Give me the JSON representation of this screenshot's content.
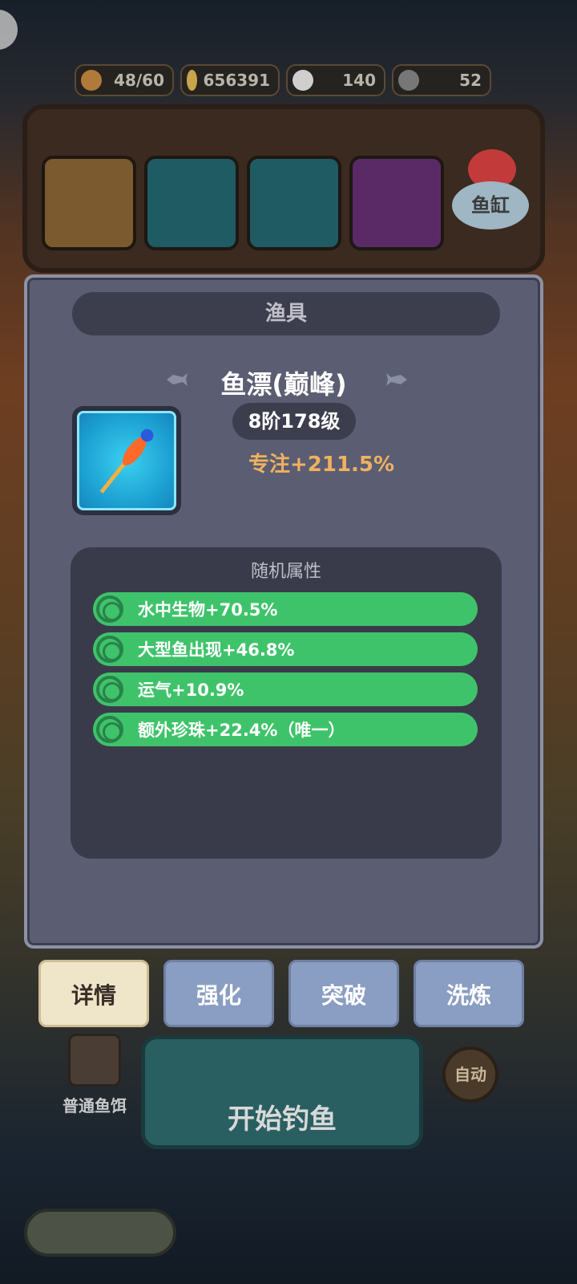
{
  "resources": [
    {
      "icon": "stamina-icon",
      "value": "48/60"
    },
    {
      "icon": "gold-coin-icon",
      "value": "656391"
    },
    {
      "icon": "pearl-icon",
      "value": "140"
    },
    {
      "icon": "fishing-line-icon",
      "value": "52"
    }
  ],
  "gear_slots": [
    {
      "name": "rod-icon"
    },
    {
      "name": "reel-icon"
    },
    {
      "name": "float-icon"
    },
    {
      "name": "hook-icon"
    }
  ],
  "fish_tank": {
    "label": "鱼缸"
  },
  "panel": {
    "header": "渔具",
    "item_name": "鱼漂(巅峰)",
    "level": "8阶178级",
    "main_stat": "专注+211.5%",
    "attributes_title": "随机属性",
    "attributes": [
      "水中生物+70.5%",
      "大型鱼出现+46.8%",
      "运气+10.9%",
      "额外珍珠+22.4%（唯一）"
    ]
  },
  "tabs": [
    "详情",
    "强化",
    "突破",
    "洗炼"
  ],
  "bait": {
    "label": "普通鱼饵",
    "count": "∞"
  },
  "start_button": "开始钓鱼",
  "auto_button": "自动",
  "colors": {
    "panel": "#5b5e72",
    "attr_green": "#3fc36a",
    "accent_orange": "#f0b160",
    "tab_active": "#efe6c9",
    "tab_inactive": "#8a9dc2"
  }
}
